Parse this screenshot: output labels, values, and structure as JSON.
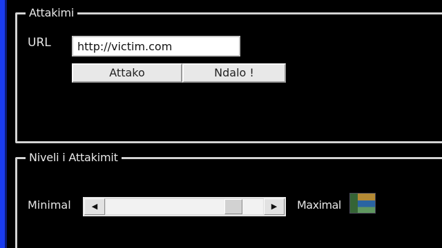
{
  "attack_group": {
    "legend": "Attakimi",
    "url_label": "URL",
    "url_value": "http://victim.com",
    "attack_button": "Attako",
    "stop_button": "Ndalo !"
  },
  "level_group": {
    "legend": "Niveli i Attakimit",
    "min_label": "Minimal",
    "max_label": "Maximal",
    "slider_level": 0.85
  },
  "colors": {
    "background": "#000000",
    "window_edge": "#1a3cf0",
    "groupbox_border": "#d4d4d4"
  },
  "icons": {
    "tray": "application-icon"
  }
}
